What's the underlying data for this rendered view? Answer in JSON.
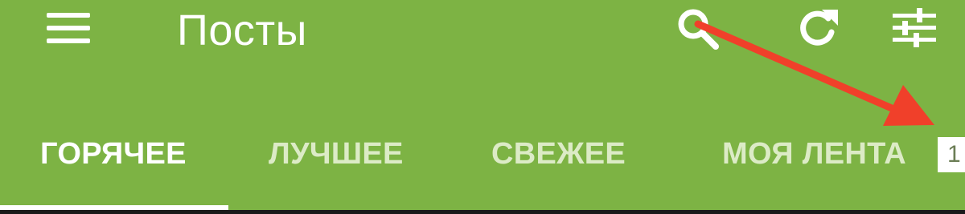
{
  "toolbar": {
    "title": "Посты",
    "icons": {
      "menu": "hamburger-menu-icon",
      "search": "search-icon",
      "refresh": "refresh-icon",
      "filters": "sliders-icon"
    }
  },
  "tabs": [
    {
      "label": "ГОРЯЧЕЕ",
      "active": true
    },
    {
      "label": "ЛУЧШЕЕ",
      "active": false
    },
    {
      "label": "СВЕЖЕЕ",
      "active": false
    },
    {
      "label": "МОЯ ЛЕНТА",
      "active": false
    }
  ],
  "badge": {
    "text": "1"
  },
  "colors": {
    "toolbar_bg": "#7db344",
    "active_text": "#ffffff",
    "inactive_text": "#dcebc6",
    "annotation_arrow": "#f0402a"
  }
}
